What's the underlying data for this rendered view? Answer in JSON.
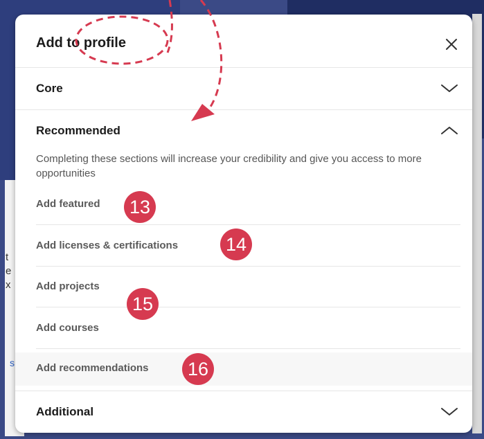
{
  "modal": {
    "title": "Add to profile",
    "sections": {
      "core": "Core",
      "recommended": "Recommended",
      "additional": "Additional"
    },
    "recommended_description": "Completing these sections will increase your credibility and give you access to more opportunities",
    "items": [
      {
        "label": "Add featured"
      },
      {
        "label": "Add licenses & certifications"
      },
      {
        "label": "Add projects"
      },
      {
        "label": "Add courses"
      },
      {
        "label": "Add recommendations"
      }
    ]
  },
  "annotations": {
    "badges": [
      "13",
      "14",
      "15",
      "16"
    ],
    "badge_color": "#d63a50"
  },
  "background": {
    "fragments": [
      "t",
      "e",
      "x"
    ],
    "link_fragment": "s"
  },
  "icons": [
    "close-icon",
    "chevron-down-icon",
    "chevron-up-icon"
  ]
}
